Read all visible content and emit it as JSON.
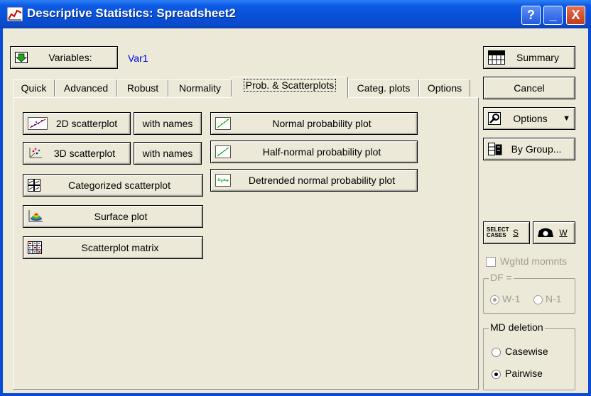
{
  "window": {
    "title": "Descriptive Statistics: Spreadsheet2",
    "help_symbol": "?",
    "minimize_symbol": "_",
    "close_symbol": "X"
  },
  "variables": {
    "button_label": "Variables:",
    "value": "Var1"
  },
  "tabs": [
    "Quick",
    "Advanced",
    "Robust",
    "Normality",
    "Prob. & Scatterplots",
    "Categ. plots",
    "Options"
  ],
  "active_tab": "Prob. & Scatterplots",
  "panel": {
    "scatter2d": "2D scatterplot",
    "with_names_1": "with names",
    "scatter3d": "3D scatterplot",
    "with_names_2": "with names",
    "categorized": "Categorized scatterplot",
    "surface": "Surface plot",
    "matrix": "Scatterplot matrix",
    "normal_prob": "Normal probability plot",
    "half_normal": "Half-normal probability plot",
    "detrended": "Detrended normal probability plot"
  },
  "right": {
    "summary": "Summary",
    "cancel": "Cancel",
    "options": "Options",
    "by_group": "By Group...",
    "select_cases_icon_text": "SELECT\nCASES",
    "select_s": "S",
    "weight_w": "W",
    "wghtd_momnts": "Wghtd momnts",
    "df_title": "DF =",
    "df_w1": "W-1",
    "df_n1": "N-1",
    "md_title": "MD deletion",
    "casewise": "Casewise",
    "pairwise": "Pairwise"
  }
}
